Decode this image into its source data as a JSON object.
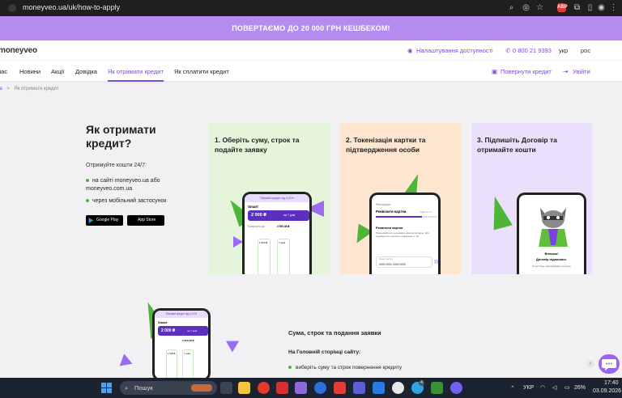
{
  "browser": {
    "url": "moneyveo.ua/uk/how-to-apply"
  },
  "promo": {
    "text": "ПОВЕРТАЄМО ДО 20 000 ГРН КЕШБЕКОМ!"
  },
  "header": {
    "logo_prefix": "mon",
    "logo_rest": "eyveo",
    "accessibility": "Налаштування доступності",
    "phone": "0 800 21 9393",
    "lang_uk": "укр",
    "lang_ru": "рос"
  },
  "nav": {
    "items": [
      "нас",
      "Новини",
      "Акції",
      "Довідка",
      "Як отримати кредит",
      "Як сплатити кредит"
    ],
    "return_credit": "Повернути кредит",
    "login": "Увійти"
  },
  "breadcrumb": {
    "home": "на",
    "sep": ">",
    "current": "Як отримати кредит"
  },
  "hero": {
    "title": "Як отримати кредит?",
    "subtitle": "Отримуйте кошти 24/7:",
    "bullet1": "на сайті moneyveo.ua або moneyveo.com.ua",
    "bullet2": "через мобільний застосунок",
    "google_play": "Google Play",
    "app_store": "App Store"
  },
  "cards": [
    {
      "title": "1. Оберіть суму, строк та подайте заявку",
      "bg": "#e4f5dc",
      "phone": {
        "header": "Перший кредит під 0,01%",
        "label": "Smart",
        "amount": "2 000 ₴",
        "side": "на 7 днів",
        "row_label": "Повернути до:",
        "row_value": "2 050,48 ₴",
        "slider1": "1 000 ₴",
        "slider2": "7 днів"
      }
    },
    {
      "title": "2. Токенізація картки та підтвердження особи",
      "bg": "#fde6cf",
      "phone": {
        "header": "Реєстрація",
        "label": "Реквізити картки",
        "side": "Крок 3 з 4",
        "card_title": "Реквізити картки",
        "card_text": "Переконайтеся, що вказали дані картки вірно. Для перевірки ми спишемо і повернемо 1 грн",
        "field_label": "Номер картки",
        "field_value": "0000 0000 0000 0000"
      }
    },
    {
      "title": "3. Підпишіть Договір та отримайте кошти",
      "bg": "#ebe0fb",
      "phone": {
        "line1": "Вітаємо!",
        "line2": "Договір підписано.",
        "line3": "Гроші буде перераховано на вашу"
      }
    }
  ],
  "section2": {
    "title": "Сума, строк та подання заявки",
    "subtitle": "На Головній сторінці сайту:",
    "bullet": "виберіть суму та строк повернення кредиту",
    "phone": {
      "header": "Перший кредит під 0,01%",
      "label": "Smart",
      "amount": "2 000 ₴",
      "side": "на 7 днів",
      "row_value": "2 050,48 ₴",
      "slider1": "1 000 ₴",
      "slider2": "7 днів"
    }
  },
  "taskbar": {
    "search": "Пошук",
    "lang": "УКР",
    "battery": "26%",
    "time": "17:40",
    "date": "03.09.2026",
    "badge": "4"
  },
  "colors": {
    "accent": "#7b4ad8",
    "brand_green": "#53b03b",
    "promo": "#b48cf0"
  }
}
